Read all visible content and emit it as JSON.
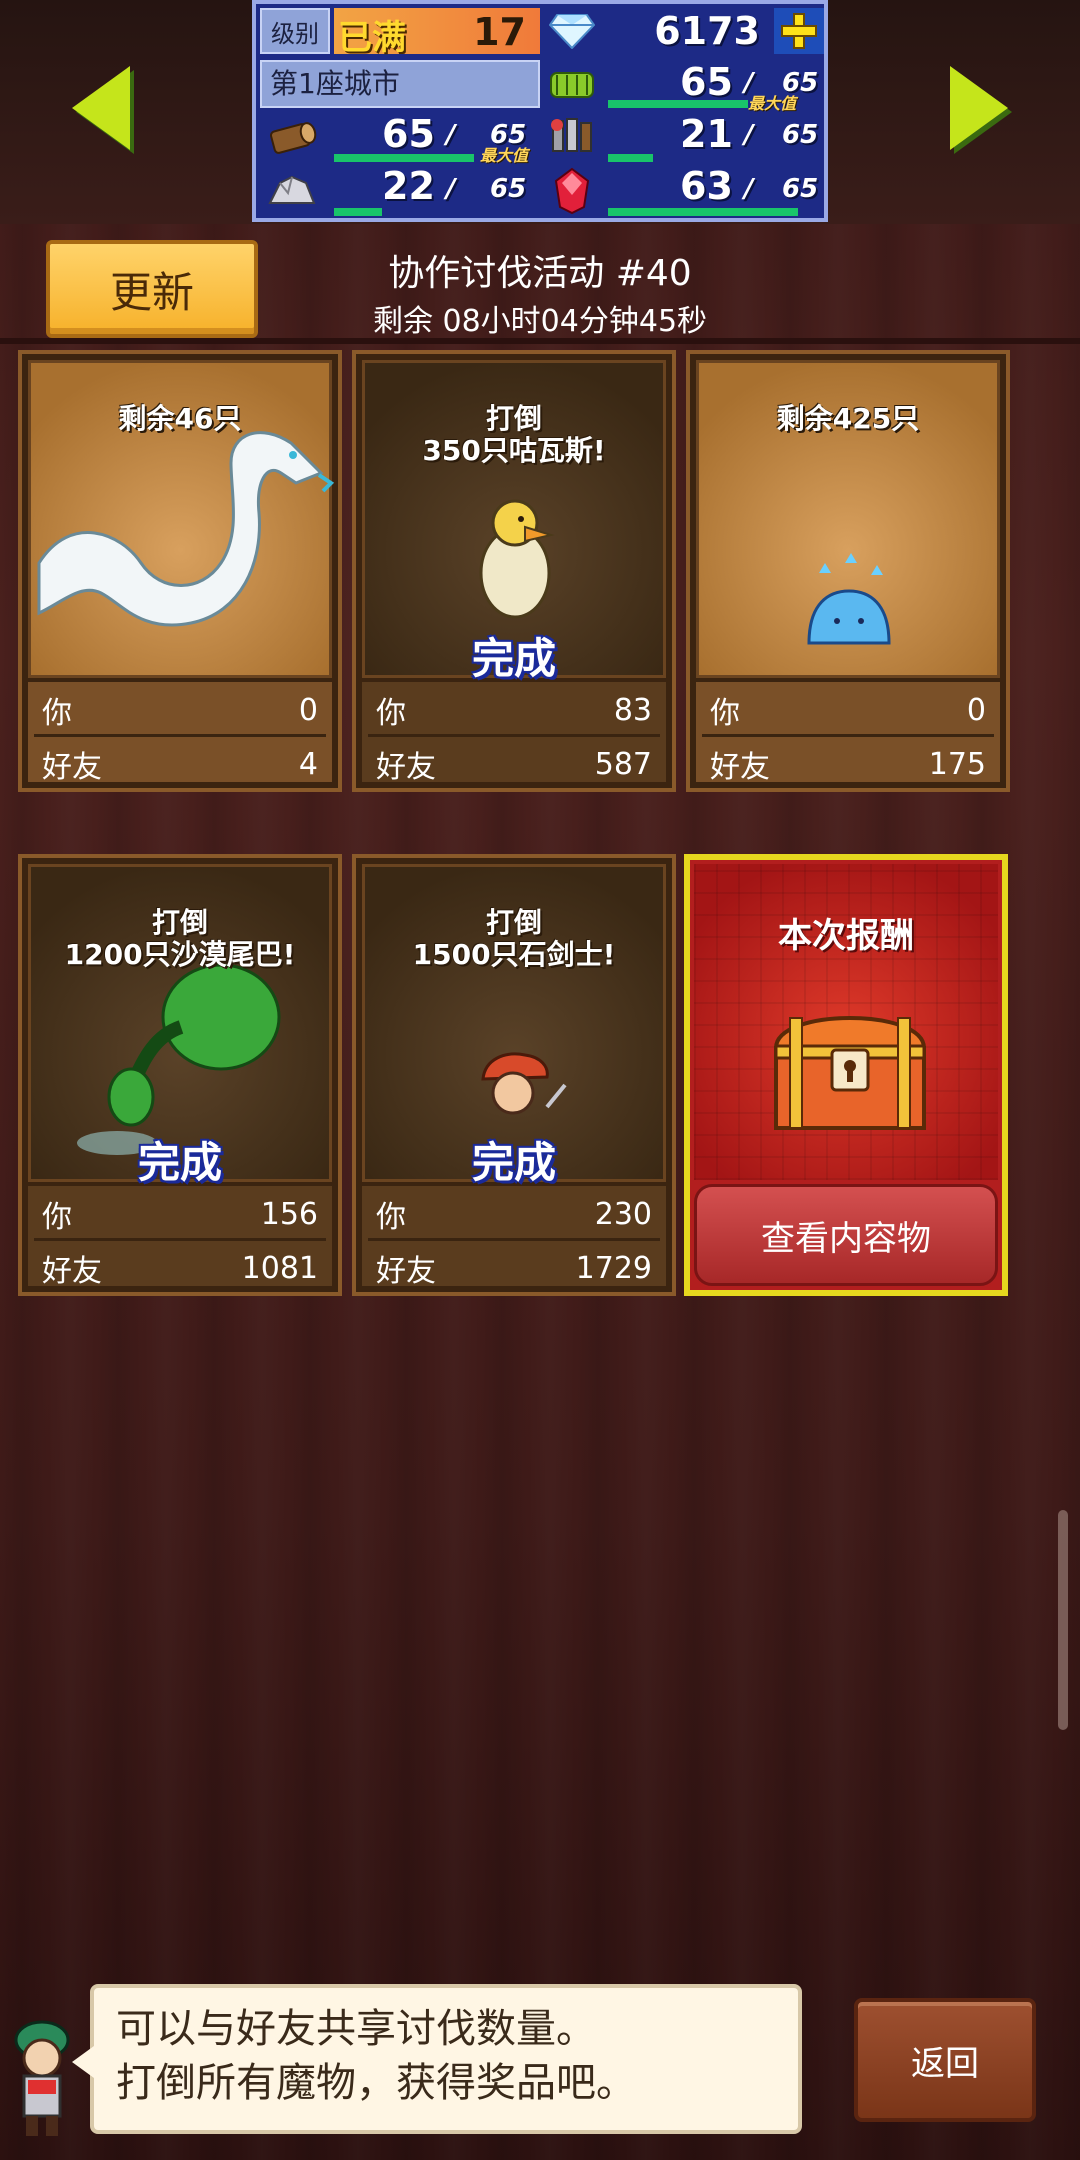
{
  "header": {
    "level_label": "级别",
    "level_badge": "已满",
    "level_value": "17",
    "gems": "6173",
    "city": "第1座城市",
    "wood_value": "65",
    "wood_max": "65",
    "wood_max_tag": "最大值",
    "wood_fill": 1.0,
    "stone_value": "22",
    "stone_max": "65",
    "stone_fill": 0.34,
    "food_value": "65",
    "food_max": "65",
    "food_max_tag": "最大值",
    "food_fill": 1.0,
    "tools_value": "21",
    "tools_max": "65",
    "tools_fill": 0.32,
    "ruby_value": "63",
    "ruby_max": "65",
    "ruby_fill": 0.97,
    "slash": "/"
  },
  "event": {
    "refresh_label": "更新",
    "title": "协作讨伐活动 #40",
    "time_left": "剩余 08小时04分钟45秒"
  },
  "cards": [
    {
      "title": "剩余46只",
      "done": "",
      "you_label": "你",
      "you": "0",
      "friend_label": "好友",
      "friend": "4"
    },
    {
      "title": "打倒\n350只咕瓦斯!",
      "title_l1": "打倒",
      "title_l2": "350只咕瓦斯!",
      "done": "完成",
      "you_label": "你",
      "you": "83",
      "friend_label": "好友",
      "friend": "587"
    },
    {
      "title": "剩余425只",
      "done": "",
      "you_label": "你",
      "you": "0",
      "friend_label": "好友",
      "friend": "175"
    },
    {
      "title_l1": "打倒",
      "title_l2": "1200只沙漠尾巴!",
      "done": "完成",
      "you_label": "你",
      "you": "156",
      "friend_label": "好友",
      "friend": "1081"
    },
    {
      "title_l1": "打倒",
      "title_l2": "1500只石剑士!",
      "done": "完成",
      "you_label": "你",
      "you": "230",
      "friend_label": "好友",
      "friend": "1729"
    }
  ],
  "reward": {
    "title": "本次报酬",
    "button": "查看内容物"
  },
  "footer": {
    "line1": "可以与好友共享讨伐数量。",
    "line2": "打倒所有魔物，获得奖品吧。",
    "back": "返回"
  },
  "colors": {
    "accent_yellow": "#c5e51b",
    "panel_blue": "#1d2a86",
    "bar_green": "#19c46a",
    "done_blue": "#1a2a9a",
    "reward_red": "#b21e1e"
  }
}
